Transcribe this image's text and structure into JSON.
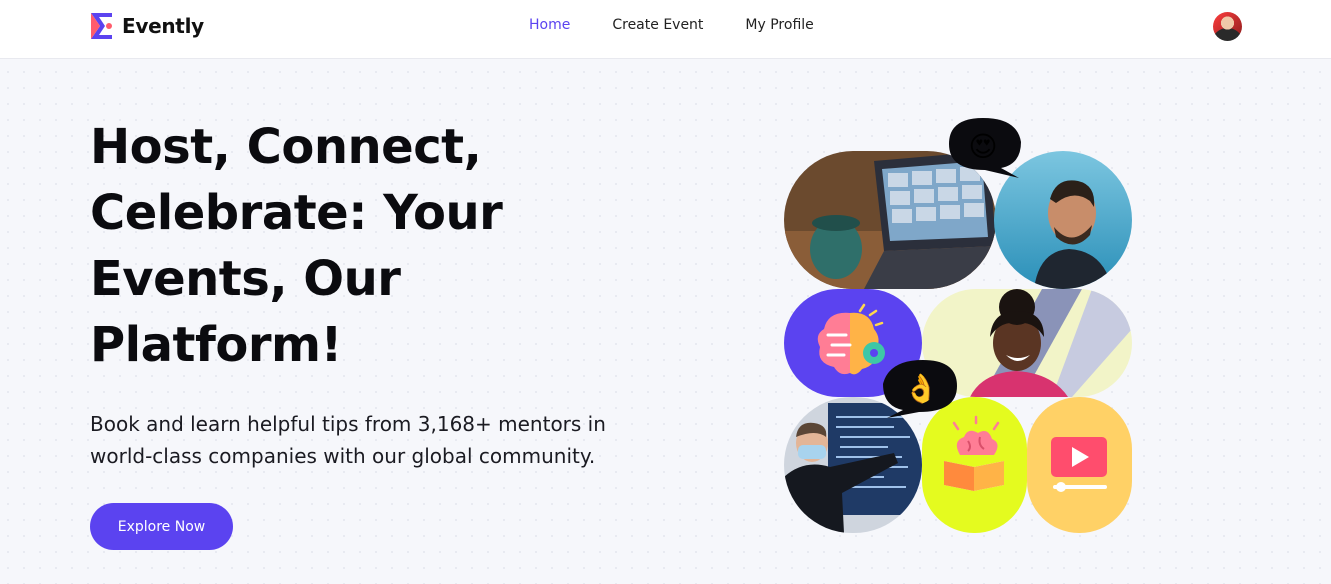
{
  "brand": {
    "name": "Evently",
    "accent": "#5b43f0"
  },
  "nav": {
    "links": [
      {
        "label": "Home",
        "active": true
      },
      {
        "label": "Create Event",
        "active": false
      },
      {
        "label": "My Profile",
        "active": false
      }
    ],
    "avatar_icon": "user-avatar"
  },
  "hero": {
    "headline": "Host, Connect, Celebrate: Your Events, Our Platform!",
    "subtitle": "Book and learn helpful tips from 3,168+ mentors in world-class companies with our global community.",
    "cta_label": "Explore Now"
  },
  "collage": {
    "bubbles": [
      {
        "emoji": "😍"
      },
      {
        "emoji": "👌"
      }
    ],
    "icons": [
      "brain-gear-icon",
      "brain-book-icon",
      "video-play-icon"
    ]
  }
}
